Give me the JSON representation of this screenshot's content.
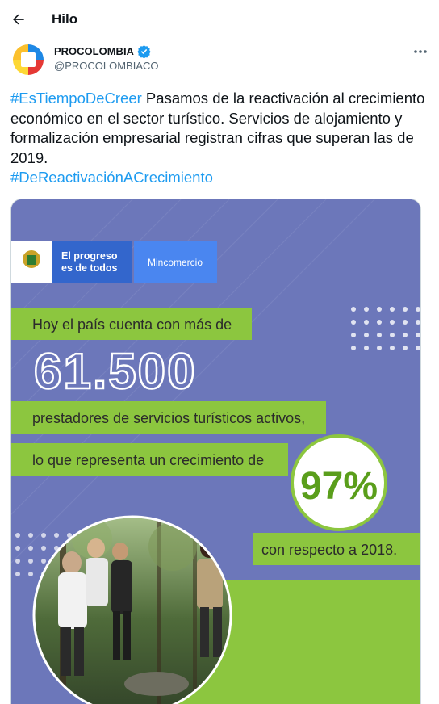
{
  "header": {
    "title": "Hilo",
    "back_icon": "arrow-left-icon"
  },
  "author": {
    "name": "PROCOLOMBIA",
    "handle": "@PROCOLOMBIACO",
    "verified_icon": "verified-badge-icon",
    "more_icon": "more-horizontal-icon"
  },
  "tweet": {
    "hashtag1": "#EsTiempoDeCreer",
    "body": " Pasamos de la reactivación al crecimiento económico en el sector turístico. Servicios de alojamiento y formalización empresarial registran cifras que superan las de 2019.",
    "hashtag2": "#DeReactivaciónACrecimiento"
  },
  "media": {
    "logo_line1": "El progreso",
    "logo_line2": "es de todos",
    "ministry": "Mincomercio",
    "line1": "Hoy el país cuenta con más de",
    "big_number": "61.500",
    "line2": "prestadores de servicios turísticos activos,",
    "line3": "lo que representa un crecimiento de",
    "percent": "97%",
    "line4": "con respecto a 2018."
  },
  "colors": {
    "accent": "#1d9bf0",
    "poster_bg": "#6c77ba",
    "green": "#8cc63f",
    "gov_blue": "#3366cc",
    "min_blue": "#4a86f0"
  }
}
